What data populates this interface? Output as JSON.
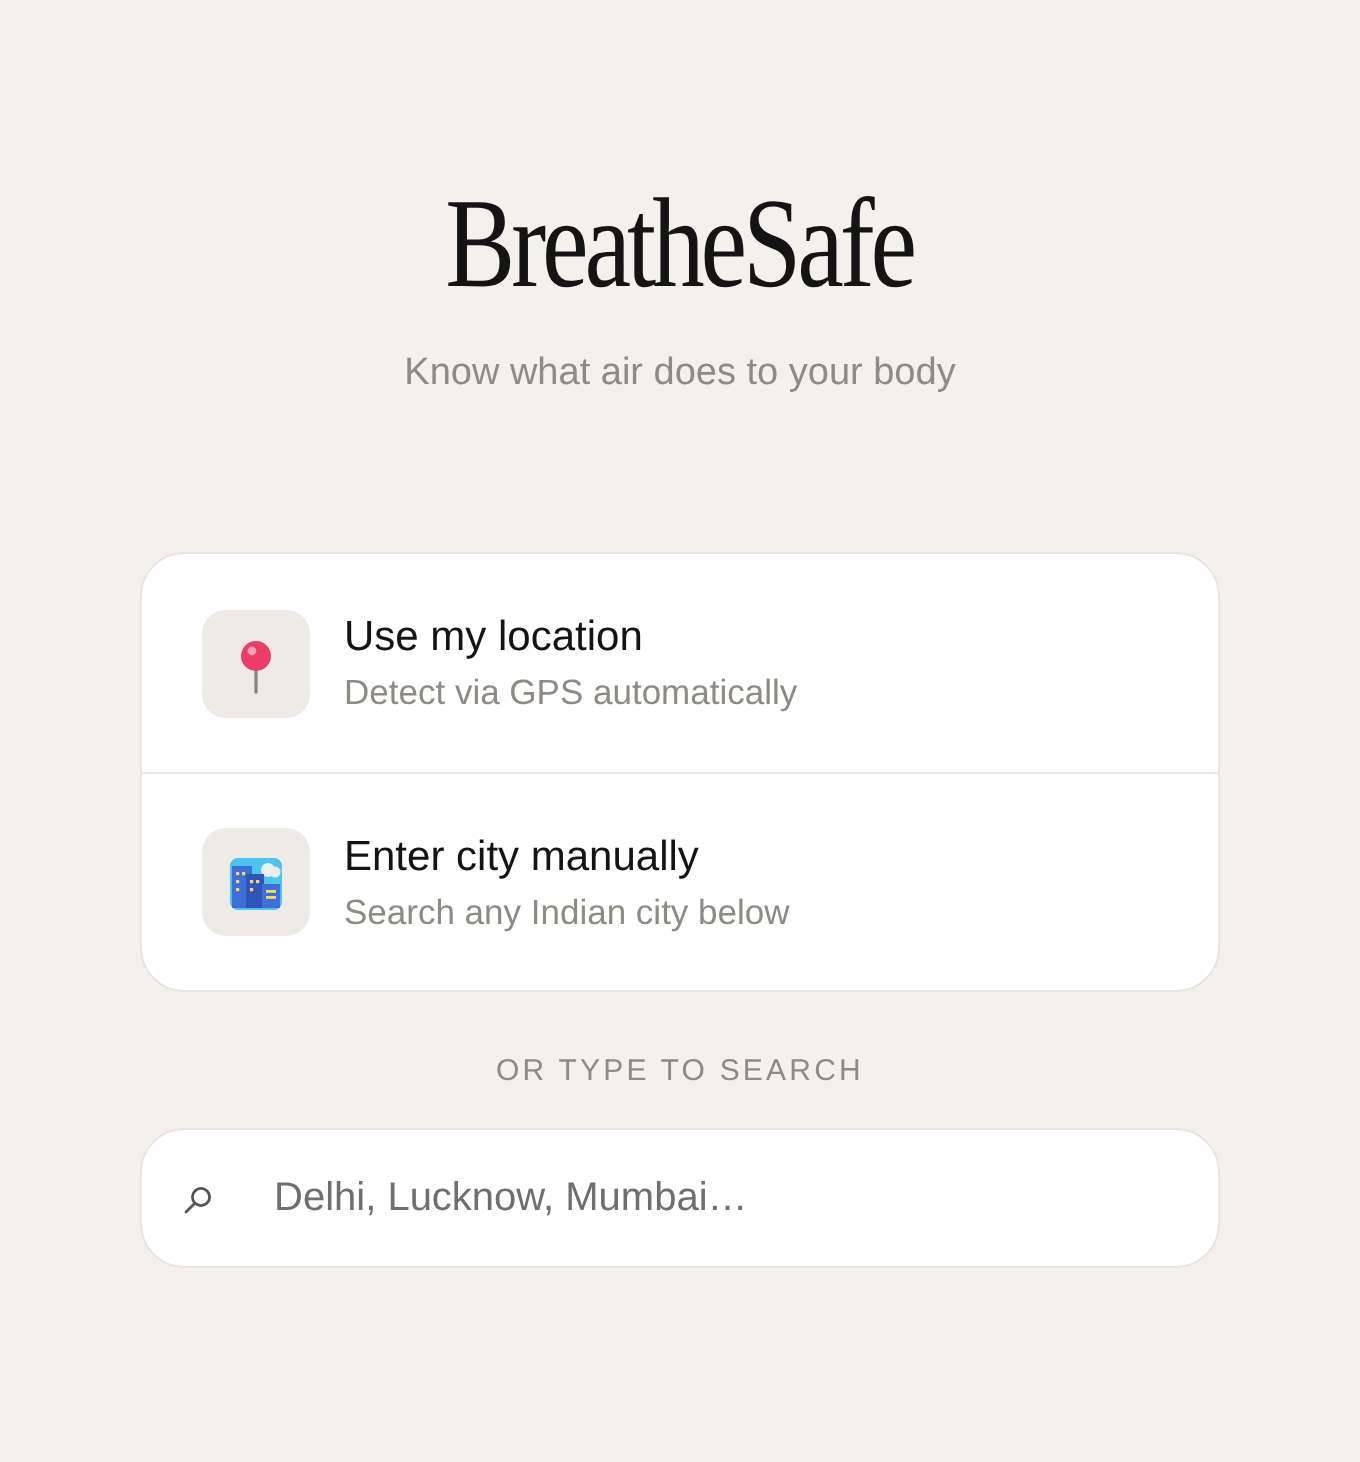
{
  "app": {
    "title": "BreatheSafe",
    "tagline": "Know what air does to your body"
  },
  "options": [
    {
      "kind": "location",
      "title": "Use my location",
      "subtitle": "Detect via GPS automatically"
    },
    {
      "kind": "city",
      "title": "Enter city manually",
      "subtitle": "Search any Indian city below"
    }
  ],
  "divider_label": "OR TYPE TO SEARCH",
  "search": {
    "placeholder": "Delhi, Lucknow, Mumbai…"
  }
}
